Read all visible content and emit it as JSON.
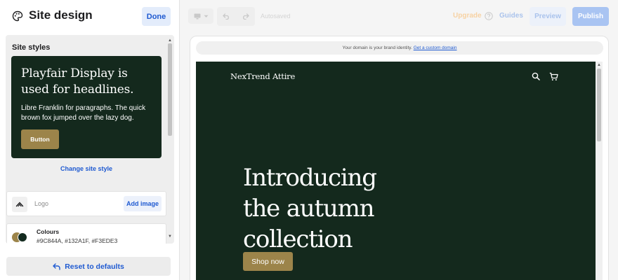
{
  "panel": {
    "title": "Site design",
    "done_label": "Done",
    "section_label": "Site styles",
    "style_card": {
      "headline": "Playfair Display is used for headlines.",
      "paragraph": "Libre Franklin for paragraphs. The quick brown fox jumped over the lazy dog.",
      "button_label": "Button"
    },
    "change_style_label": "Change site style",
    "logo": {
      "label": "Logo",
      "add_image_label": "Add image"
    },
    "colours": {
      "label": "Colours",
      "values": "#9C844A, #132A1F, #F3EDE3",
      "swatches": [
        "#9C844A",
        "#132A1F",
        "#F3EDE3"
      ]
    },
    "reset_label": "Reset to defaults"
  },
  "topbar": {
    "device_icon": "monitor-icon",
    "autosave_label": "Autosaved",
    "upgrade_label": "Upgrade",
    "guides_label": "Guides",
    "preview_label": "Preview",
    "publish_label": "Publish"
  },
  "preview": {
    "banner_text": "Your domain is your brand identity.",
    "banner_link": "Get a custom domain",
    "brand": "NexTrend Attire",
    "hero_heading": "Introducing the autumn collection",
    "cta_label": "Shop now"
  },
  "colors": {
    "accent": "#1F5AD1",
    "brand_gold": "#9C844A",
    "brand_green": "#14291D",
    "upgrade": "#F7D2A3"
  }
}
